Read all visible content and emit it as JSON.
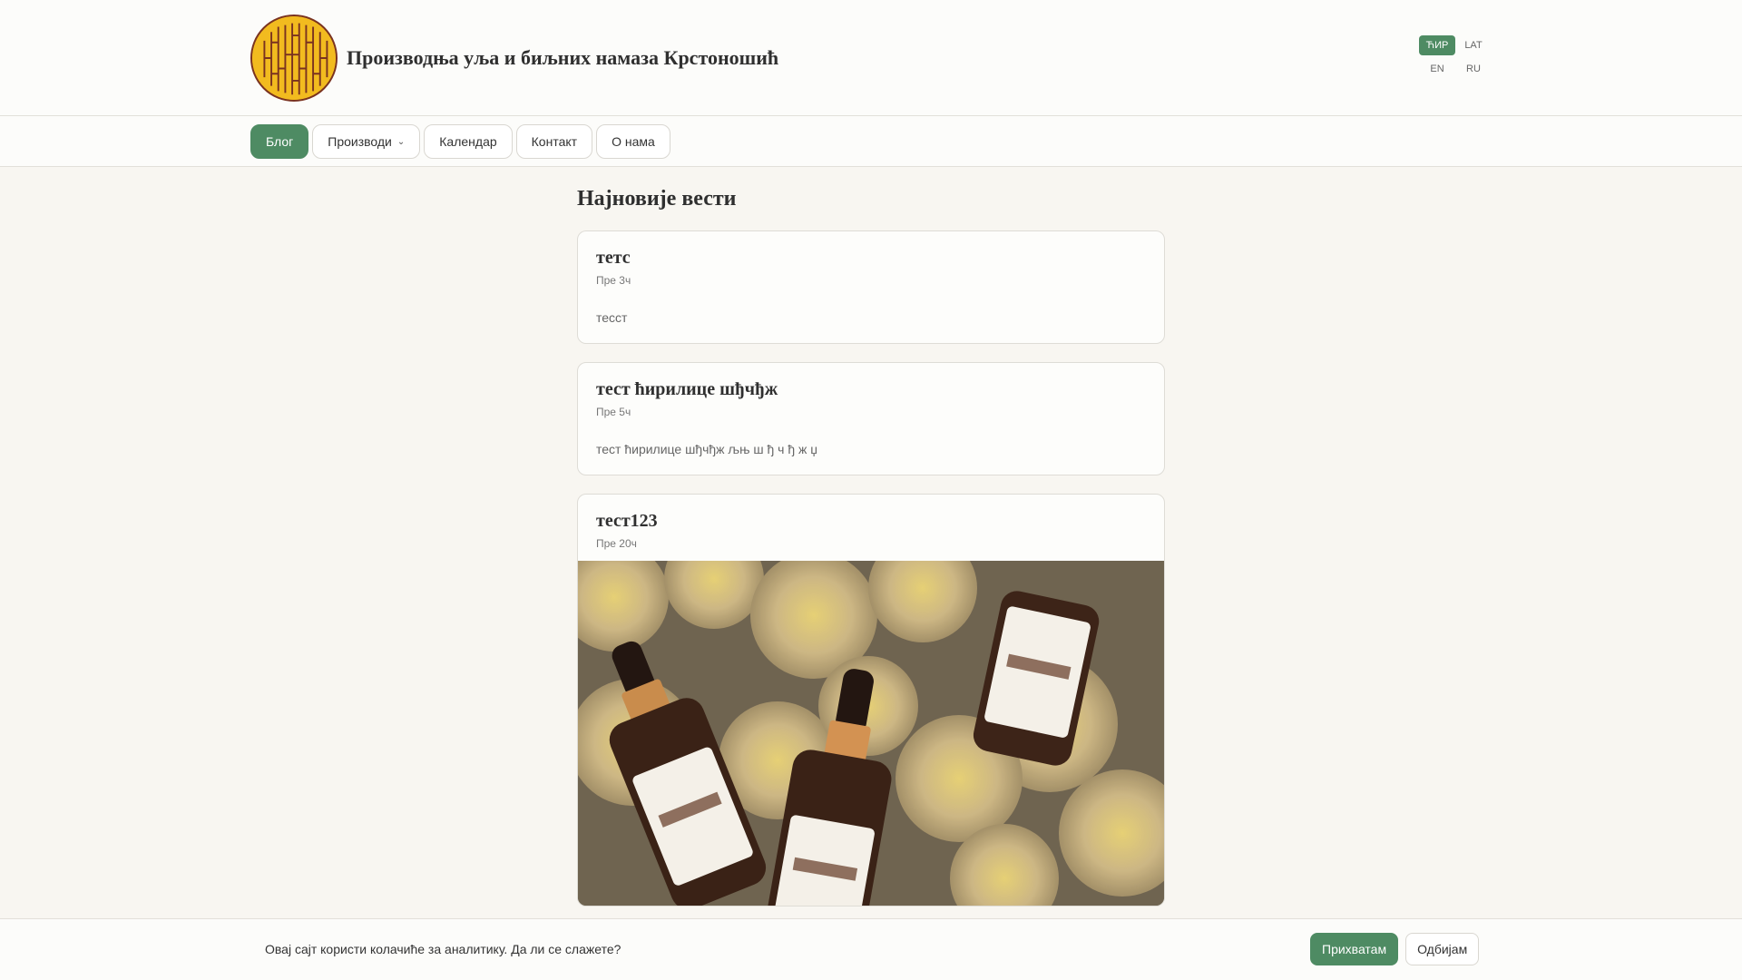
{
  "header": {
    "site_title": "Производња уља и биљних намаза Крстоношић",
    "languages": [
      "ЋИР",
      "LAT",
      "EN",
      "RU"
    ],
    "active_language": "ЋИР"
  },
  "nav": {
    "items": [
      {
        "label": "Блог",
        "active": true
      },
      {
        "label": "Производи",
        "has_dropdown": true
      },
      {
        "label": "Календар"
      },
      {
        "label": "Контакт"
      },
      {
        "label": "О нама"
      }
    ]
  },
  "main": {
    "section_title": "Најновије вести",
    "posts": [
      {
        "title": "тетс",
        "time": "Пре 3ч",
        "body": "тесст"
      },
      {
        "title": "тест ћирилице шђчђж",
        "time": "Пре 5ч",
        "body": "тест ћирилице шђчђж љњ ш ђ ч ђ ж џ"
      },
      {
        "title": "тест123",
        "time": "Пре 20ч",
        "has_image": true
      }
    ]
  },
  "cookie": {
    "text": "Овај сајт користи колачиће за аналитику. Да ли се слажете?",
    "accept": "Прихватам",
    "decline": "Одбијам"
  },
  "colors": {
    "accent": "#4e8b63",
    "logo_fill": "#f2bb1f",
    "logo_line": "#7a3320",
    "background": "#f8f6f1"
  }
}
